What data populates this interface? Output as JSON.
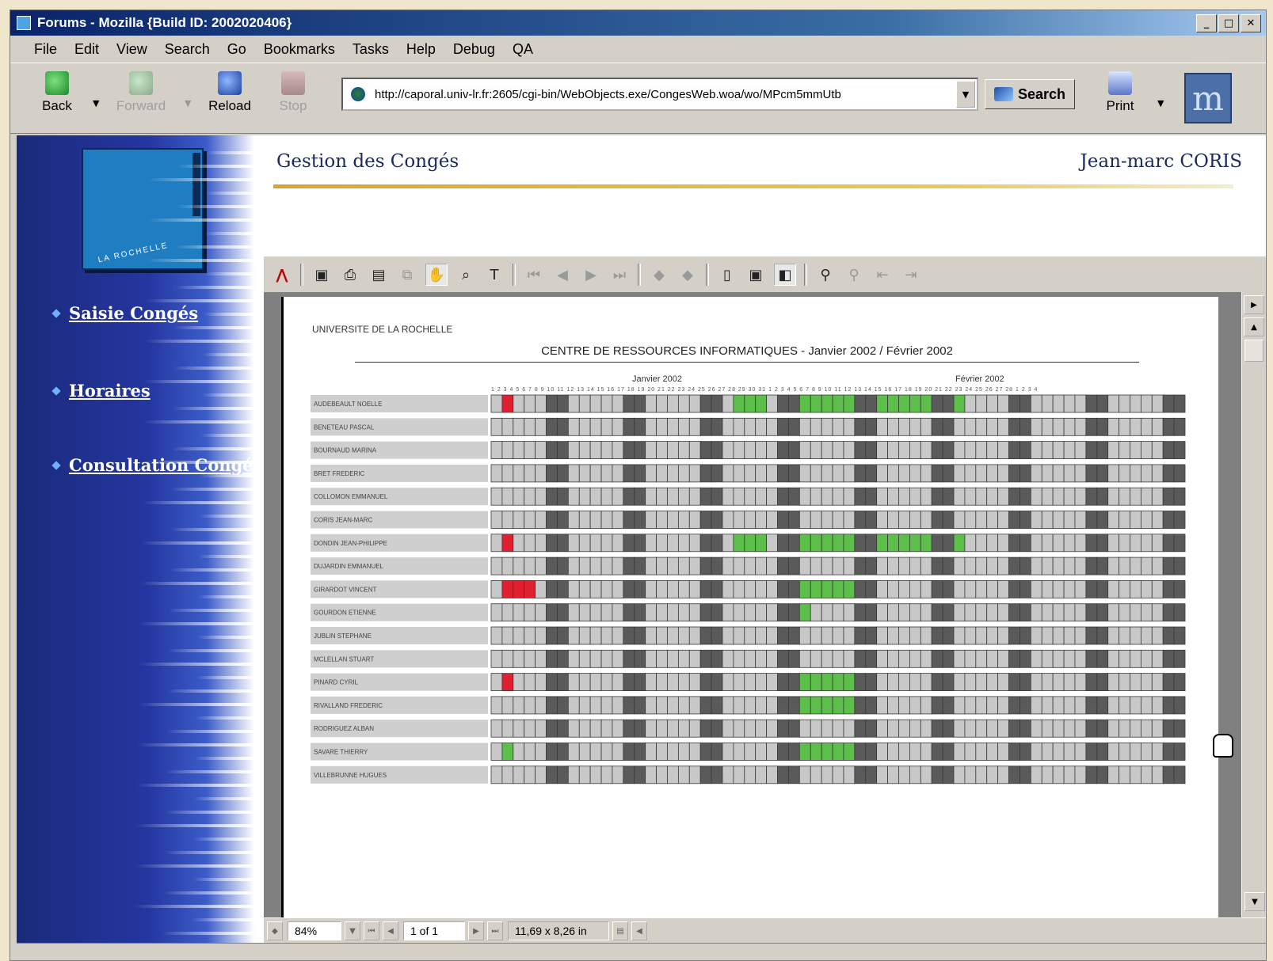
{
  "window": {
    "title": "Forums - Mozilla {Build ID: 2002020406}"
  },
  "menu": [
    "File",
    "Edit",
    "View",
    "Search",
    "Go",
    "Bookmarks",
    "Tasks",
    "Help",
    "Debug",
    "QA"
  ],
  "nav": {
    "back": "Back",
    "forward": "Forward",
    "reload": "Reload",
    "stop": "Stop",
    "url": "http://caporal.univ-lr.fr:2605/cgi-bin/WebObjects.exe/CongesWeb.woa/wo/MPcm5mmUtb",
    "search": "Search",
    "print": "Print"
  },
  "page": {
    "app_title": "Gestion des Congés",
    "user_name": "Jean-marc CORIS"
  },
  "sidebar": {
    "logo_text": "LA ROCHELLE",
    "links": [
      "Saisie Congés",
      "Horaires",
      "Consultation Congés"
    ]
  },
  "pdf": {
    "org": "UNIVERSITE DE LA ROCHELLE",
    "title": "CENTRE DE RESSOURCES INFORMATIQUES - Janvier 2002 / Février 2002",
    "month1": "Janvier 2002",
    "month2": "Février 2002",
    "day_numbers": "1 2 3 4 5 6 7 8 9 10 11 12 13 14 15 16 17 18 19 20 21 22 23 24 25 26 27 28 29 30 31 1 2 3 4 5 6 7 8 9 10 11 12 13 14 15 16 17 18 19 20 21 22 23 24 25 26 27 28 1 2 3 4",
    "employees": [
      "AUDEBEAULT NOELLE",
      "BENETEAU PASCAL",
      "BOURNAUD MARINA",
      "BRET FREDERIC",
      "COLLOMON EMMANUEL",
      "CORIS JEAN-MARC",
      "DONDIN JEAN-PHILIPPE",
      "DUJARDIN EMMANUEL",
      "GIRARDOT VINCENT",
      "GOURDON ETIENNE",
      "JUBLIN STEPHANE",
      "MCLELLAN STUART",
      "PINARD CYRIL",
      "RIVALLAND FREDERIC",
      "RODRIGUEZ ALBAN",
      "SAVARE THIERRY",
      "VILLEBRUNNE HUGUES"
    ]
  },
  "pdf_status": {
    "zoom": "84%",
    "page": "1 of 1",
    "size": "11,69 x 8,26 in"
  },
  "colors": {
    "weekend": "#5a5a5a",
    "workday": "#c8c8c8",
    "leave": "#5cbf4a",
    "absence": "#e02030",
    "name_bg": "#cfcfcf"
  },
  "calendar": {
    "days": 63,
    "weekend_days": [
      5,
      6,
      12,
      13,
      19,
      20,
      26,
      27,
      33,
      34,
      40,
      41,
      47,
      48,
      54,
      55,
      61,
      62
    ],
    "marks": [
      [
        {
          "from": 1,
          "to": 1,
          "type": "absence"
        },
        {
          "from": 22,
          "to": 24,
          "type": "leave"
        },
        {
          "from": 28,
          "to": 32,
          "type": "leave"
        },
        {
          "from": 35,
          "to": 39,
          "type": "leave"
        },
        {
          "from": 42,
          "to": 42,
          "type": "leave"
        }
      ],
      [],
      [],
      [],
      [],
      [],
      [
        {
          "from": 1,
          "to": 1,
          "type": "absence"
        },
        {
          "from": 22,
          "to": 24,
          "type": "leave"
        },
        {
          "from": 28,
          "to": 32,
          "type": "leave"
        },
        {
          "from": 35,
          "to": 39,
          "type": "leave"
        },
        {
          "from": 42,
          "to": 42,
          "type": "leave"
        }
      ],
      [],
      [
        {
          "from": 1,
          "to": 3,
          "type": "absence"
        },
        {
          "from": 28,
          "to": 32,
          "type": "leave"
        }
      ],
      [
        {
          "from": 28,
          "to": 28,
          "type": "leave"
        }
      ],
      [],
      [],
      [
        {
          "from": 1,
          "to": 1,
          "type": "absence"
        },
        {
          "from": 28,
          "to": 32,
          "type": "leave"
        }
      ],
      [
        {
          "from": 28,
          "to": 32,
          "type": "leave"
        }
      ],
      [],
      [
        {
          "from": 1,
          "to": 1,
          "type": "leave"
        },
        {
          "from": 28,
          "to": 32,
          "type": "leave"
        }
      ],
      []
    ]
  }
}
